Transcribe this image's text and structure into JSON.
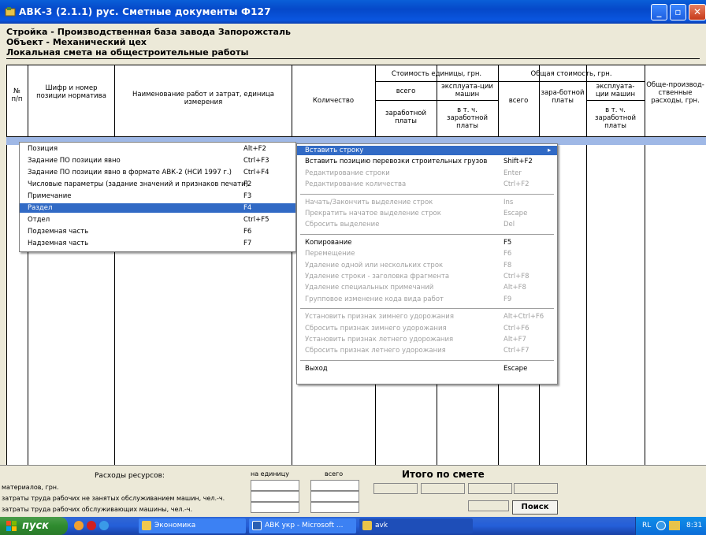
{
  "window": {
    "title": "АВК-3 (2.1.1)  рус.  Сметные документы        Ф127"
  },
  "header": {
    "line1": "Стройка - Производственная база завода Запорожсталь",
    "line2": "Объект - Механический цех",
    "line3": "Локальная смета на общестроительные работы"
  },
  "table": {
    "col_num": "№\nп/п",
    "col_code": "Шифр и номер позиции норматива",
    "col_name": "Наименование работ и затрат, единица измерения",
    "col_qty": "Количество",
    "grp_unit": "Стоимость единицы, грн.",
    "unit_total": "всего",
    "unit_wages": "заработной платы",
    "unit_machines": "эксплуата-ции машин",
    "unit_machines_wages": "в т. ч. заработной платы",
    "grp_total": "Общая стоимость, грн.",
    "total_all": "всего",
    "total_wages": "зара-ботной платы",
    "total_machines": "эксплуата-ции машин",
    "total_machines_wages": "в т. ч. заработной платы",
    "col_overhead": "Обще-производ-ственные расходы, грн."
  },
  "left_menu": {
    "items": [
      {
        "label": "Позиция",
        "shortcut": "Alt+F2",
        "highlighted": false
      },
      {
        "label": "Задание ПО позиции явно",
        "shortcut": "Ctrl+F3",
        "highlighted": false
      },
      {
        "label": "Задание ПО позиции явно в формате АВК-2 (НСИ 1997 г.)",
        "shortcut": "Ctrl+F4",
        "highlighted": false
      },
      {
        "label": "Числовые параметры (задание значений и признаков печати)",
        "shortcut": "F2",
        "highlighted": false
      },
      {
        "label": "Примечание",
        "shortcut": "F3",
        "highlighted": false
      },
      {
        "label": "Раздел",
        "shortcut": "F4",
        "highlighted": true
      },
      {
        "label": "Отдел",
        "shortcut": "Ctrl+F5",
        "highlighted": false
      },
      {
        "label": "Подземная часть",
        "shortcut": "F6",
        "highlighted": false
      },
      {
        "label": "Надземная часть",
        "shortcut": "F7",
        "highlighted": false
      }
    ]
  },
  "context_menu": {
    "items": [
      {
        "label": "Вставить строку",
        "shortcut": "",
        "state": "highlighted",
        "submenu": true
      },
      {
        "label": "Вставить позицию перевозки строительных грузов",
        "shortcut": "Shift+F2",
        "state": "enabled"
      },
      {
        "label": "Редактирование строки",
        "shortcut": "Enter",
        "state": "disabled"
      },
      {
        "label": "Редактирование количества",
        "shortcut": "Ctrl+F2",
        "state": "disabled"
      },
      {
        "label": "Начать/Закончить выделение строк",
        "shortcut": "Ins",
        "state": "disabled"
      },
      {
        "label": "Прекратить начатое выделение строк",
        "shortcut": "Escape",
        "state": "disabled"
      },
      {
        "label": "Сбросить выделение",
        "shortcut": "Del",
        "state": "disabled"
      },
      {
        "label": "Копирование",
        "shortcut": "F5",
        "state": "enabled"
      },
      {
        "label": "Перемещение",
        "shortcut": "F6",
        "state": "disabled"
      },
      {
        "label": "Удаление одной или нескольких строк",
        "shortcut": "F8",
        "state": "disabled"
      },
      {
        "label": "Удаление строки - заголовка фрагмента",
        "shortcut": "Ctrl+F8",
        "state": "disabled"
      },
      {
        "label": "Удаление специальных примечаний",
        "shortcut": "Alt+F8",
        "state": "disabled"
      },
      {
        "label": "Групповое изменение кода вида работ",
        "shortcut": "F9",
        "state": "disabled"
      },
      {
        "label": "Установить признак зимнего удорожания",
        "shortcut": "Alt+Ctrl+F6",
        "state": "disabled"
      },
      {
        "label": "Сбросить признак зимнего удорожания",
        "shortcut": "Ctrl+F6",
        "state": "disabled"
      },
      {
        "label": "Установить признак летнего удорожания",
        "shortcut": "Alt+F7",
        "state": "disabled"
      },
      {
        "label": "Сбросить признак летнего удорожания",
        "shortcut": "Ctrl+F7",
        "state": "disabled"
      },
      {
        "label": "Выход",
        "shortcut": "Escape",
        "state": "enabled"
      }
    ]
  },
  "bottom": {
    "resources_label": "Расходы ресурсов:",
    "per_unit": "на единицу",
    "total": "всего",
    "materials": "материалов, грн.",
    "labor_not_machines": "затраты труда рабочих не занятых обслуживанием машин, чел.-ч.",
    "labor_machines": "затраты труда рабочих обслуживающих машины, чел.-ч.",
    "itogo": "Итого   по   смете",
    "search": "Поиск"
  },
  "taskbar": {
    "start": "пуск",
    "items": [
      "Экономика",
      "АВК укр - Microsoft ...",
      "avk"
    ],
    "lang": "RL",
    "clock": "8:31"
  }
}
